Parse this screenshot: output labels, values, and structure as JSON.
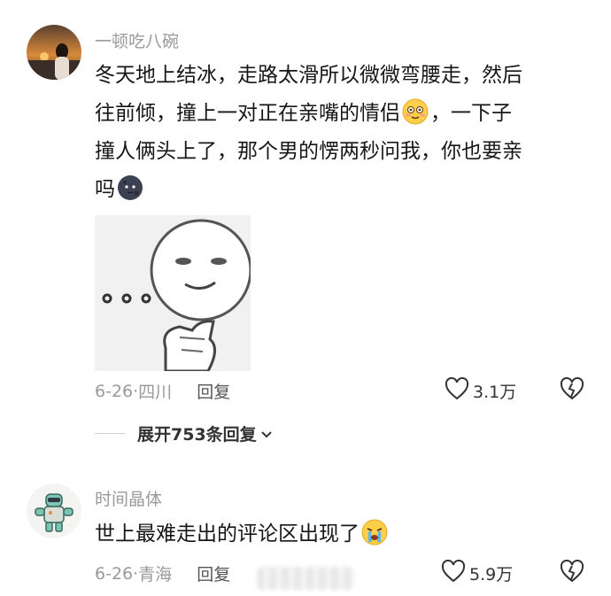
{
  "comments": [
    {
      "username": "一顿吃八碗",
      "line1": "冬天地上结冰，走路太滑所以微微弯腰走，然后",
      "line2a": "往前倾，撞上一对正在亲嘴的情侣",
      "line2b": "，一下子",
      "line3": "撞人俩头上了，那个男的愣两秒问我，你也要亲",
      "line4": "吗",
      "date": "6-26",
      "location": "四川",
      "reply_label": "回复",
      "likes": "3.1万",
      "expand_label": "展开753条回复",
      "sticker_icon": "thinking-face-meme",
      "emoji1": "smiling-face-icon",
      "emoji2": "dark-moon-face-icon"
    },
    {
      "username": "时间晶体",
      "text": "世上最难走出的评论区出现了",
      "date": "6-26",
      "location": "青海",
      "reply_label": "回复",
      "likes": "5.9万",
      "emoji": "crying-face-icon"
    }
  ],
  "colors": {
    "meta": "#9a9a9a",
    "text": "#161616"
  }
}
